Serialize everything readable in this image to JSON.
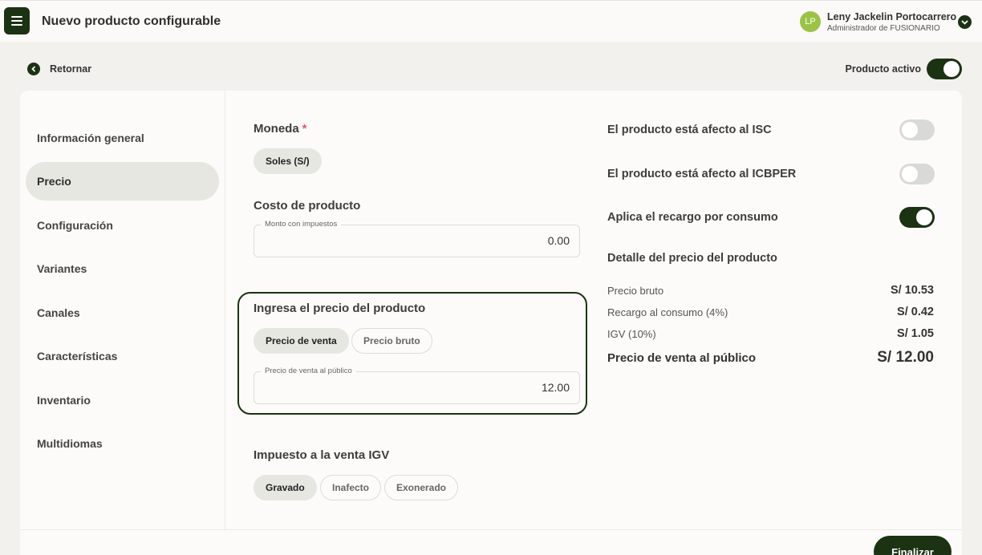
{
  "header": {
    "title": "Nuevo producto configurable",
    "user": {
      "initials": "LP",
      "name": "Leny Jackelin Portocarrero",
      "role": "Administrador de FUSIONARIO"
    }
  },
  "topbar": {
    "back_label": "Retornar",
    "active_label": "Producto activo",
    "active_on": true
  },
  "sidebar": {
    "items": [
      {
        "label": "Información general"
      },
      {
        "label": "Precio"
      },
      {
        "label": "Configuración"
      },
      {
        "label": "Variantes"
      },
      {
        "label": "Canales"
      },
      {
        "label": "Características"
      },
      {
        "label": "Inventario"
      },
      {
        "label": "Multidiomas"
      }
    ],
    "active_index": 1
  },
  "currency": {
    "label": "Moneda",
    "required_mark": "*",
    "options": [
      "Soles (S/)"
    ],
    "selected": "Soles (S/)"
  },
  "cost": {
    "label": "Costo de producto",
    "field_label": "Monto con impuestos",
    "value": "0.00"
  },
  "price_input": {
    "label": "Ingresa el precio del producto",
    "options": [
      "Precio de venta",
      "Precio bruto"
    ],
    "selected": "Precio de venta",
    "field_label": "Precio de venta al público",
    "value": "12.00"
  },
  "tax": {
    "label": "Impuesto a la venta IGV",
    "options": [
      "Gravado",
      "Inafecto",
      "Exonerado"
    ],
    "selected": "Gravado"
  },
  "options": [
    {
      "label": "El producto está afecto al ISC",
      "on": false
    },
    {
      "label": "El producto está afecto al ICBPER",
      "on": false
    },
    {
      "label": "Aplica el recargo por consumo",
      "on": true
    }
  ],
  "detail": {
    "title": "Detalle del precio del producto",
    "rows": [
      {
        "label": "Precio bruto",
        "value": "S/ 10.53"
      },
      {
        "label": "Recargo al consumo (4%)",
        "value": "S/ 0.42"
      },
      {
        "label": "IGV (10%)",
        "value": "S/ 1.05"
      }
    ],
    "total": {
      "label": "Precio de venta al público",
      "value": "S/ 12.00"
    }
  },
  "footer": {
    "finish_label": "Finalizar"
  },
  "colors": {
    "accent": "#1b3213",
    "chip_selected": "#e5e7e0",
    "avatar": "#9bc346",
    "required": "#e0556b"
  }
}
